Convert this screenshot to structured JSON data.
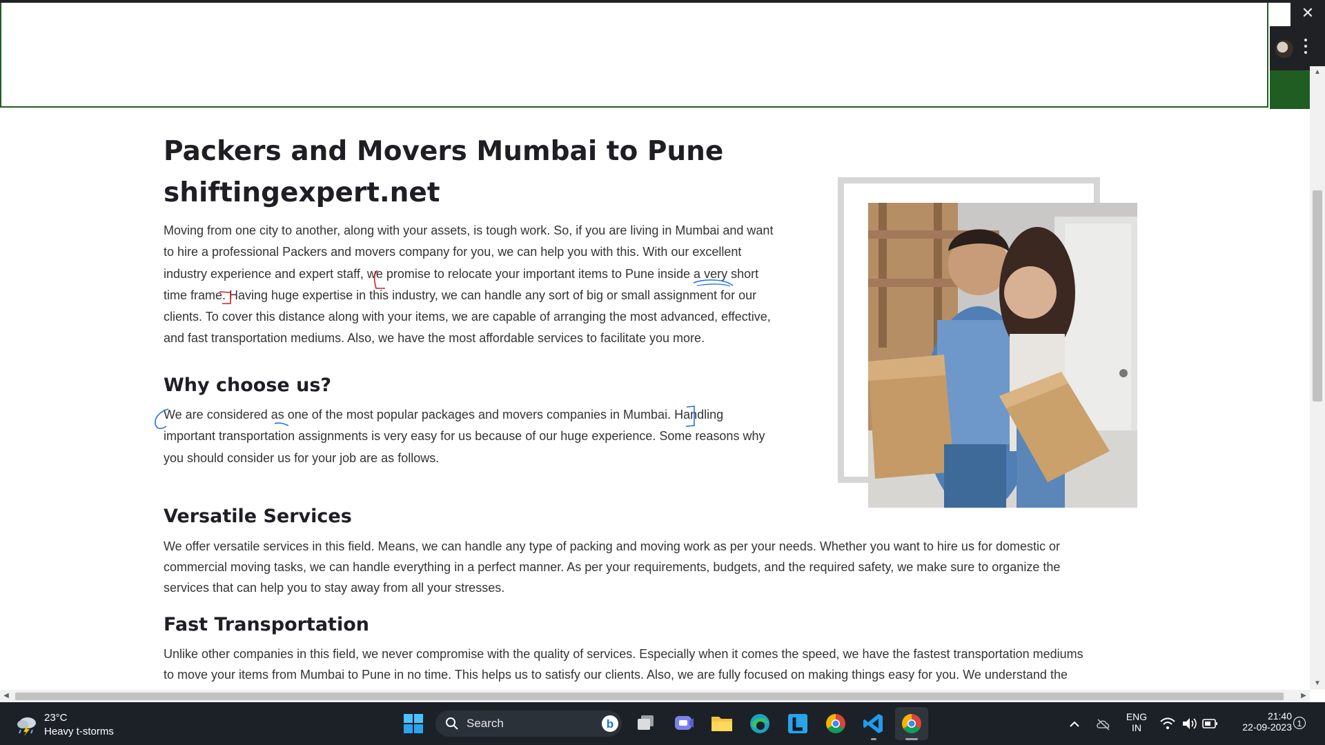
{
  "window": {
    "close_glyph": "✕"
  },
  "article": {
    "title_line1": "Packers and Movers Mumbai to Pune",
    "title_line2": "shiftingexpert.net",
    "intro_lines": [
      "Moving from one city to another, along with your assets, is tough work. So, if you are living in Mumbai and want",
      "to hire a professional Packers and movers company for you, we can help you with this. With our excellent",
      "industry experience and expert staff, we promise to relocate your important items to Pune inside a very short",
      "time frame. Having huge expertise in this industry, we can handle any sort of big or small assignment for our",
      "clients. To cover this distance along with your items, we are capable of arranging the most advanced, effective,",
      "and fast transportation mediums. Also, we have the most affordable services to facilitate you more."
    ],
    "why_heading": "Why choose us?",
    "why_lines": [
      "We are considered as one of the most popular packages and movers companies in Mumbai. Handling",
      "important transportation assignments is very easy for us because of our huge experience. Some reasons why",
      "you should consider us for your job are as follows."
    ],
    "versatile_heading": "Versatile Services",
    "versatile_lines": [
      "We offer versatile services in this field. Means, we can handle any type of packing and moving work as per your needs. Whether you want to hire us for domestic or",
      "commercial moving tasks, we can handle everything in a perfect manner. As per your requirements, budgets, and the required safety, we make sure to organize the",
      "services that can help you to stay away from all your stresses."
    ],
    "fast_heading": "Fast Transportation",
    "fast_lines": [
      "Unlike other companies in this field, we never compromise with the quality of services. Especially when it comes the speed, we have the fastest transportation mediums",
      "to move your items from Mumbai to Pune in no time. This helps us to satisfy our clients. Also, we are fully focused on making things easy for you. We understand the"
    ]
  },
  "taskbar": {
    "weather_temp": "23°C",
    "weather_desc": "Heavy t-storms",
    "search_label": "Search",
    "lang_line1": "ENG",
    "lang_line2": "IN",
    "time": "21:40",
    "date": "22-09-2023",
    "notification_count": "1"
  },
  "icons": [
    "close-icon",
    "avatar",
    "more-vert-icon",
    "weather-icon",
    "windows-start-icon",
    "search-icon",
    "bing-icon",
    "task-view-icon",
    "teams-chat-icon",
    "file-explorer-icon",
    "edge-icon",
    "l-app-icon",
    "chrome-icon",
    "vscode-icon",
    "chevron-up-icon",
    "cloud-off-icon",
    "wifi-icon",
    "volume-icon",
    "battery-icon"
  ],
  "colors": {
    "accent_green": "#1f5d23",
    "taskbar": "#1c2128",
    "heading": "#1e1e24",
    "body_text": "#333333"
  }
}
